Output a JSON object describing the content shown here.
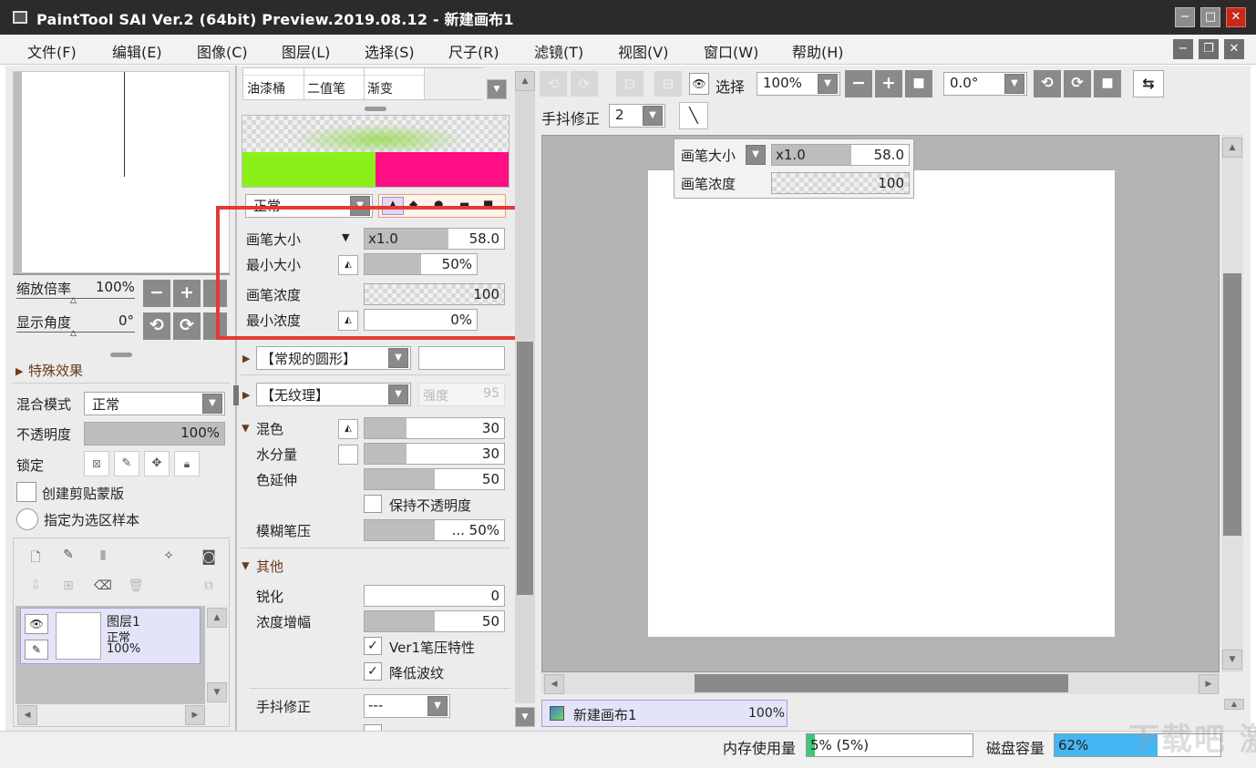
{
  "window": {
    "title": "PaintTool SAI Ver.2 (64bit) Preview.2019.08.12 - 新建画布1"
  },
  "menu": [
    "文件(F)",
    "编辑(E)",
    "图像(C)",
    "图层(L)",
    "选择(S)",
    "尺子(R)",
    "滤镜(T)",
    "视图(V)",
    "窗口(W)",
    "帮助(H)"
  ],
  "nav": {
    "zoom_label": "缩放倍率",
    "zoom_value": "100%",
    "angle_label": "显示角度",
    "angle_value": "0°"
  },
  "layer_props": {
    "effects_label": "特殊效果",
    "blend_label": "混合模式",
    "blend_value": "正常",
    "opacity_label": "不透明度",
    "opacity_value": "100%",
    "lock_label": "锁定",
    "clip_label": "创建剪贴蒙版",
    "selection_source_label": "指定为选区样本"
  },
  "layers": [
    {
      "name": "图层1",
      "mode": "正常",
      "opacity": "100%"
    }
  ],
  "tools": [
    "油漆桶",
    "二值笔",
    "渐变"
  ],
  "brush": {
    "mode_value": "正常",
    "size_label": "画笔大小",
    "size_multiplier": "x1.0",
    "size_value": "58.0",
    "size_fill": 0.6,
    "min_size_label": "最小大小",
    "min_size_value": "50%",
    "min_size_fill": 0.5,
    "density_label": "画笔浓度",
    "density_value": "100",
    "min_density_label": "最小浓度",
    "min_density_value": "0%",
    "shape_value": "【常规的圆形】",
    "texture_value": "【无纹理】",
    "strength_label": "强度",
    "strength_value": "95",
    "blending_label": "混色",
    "blending_value": "30",
    "blending_fill": 0.3,
    "water_label": "水分量",
    "water_value": "30",
    "water_fill": 0.3,
    "persistence_label": "色延伸",
    "persistence_value": "50",
    "persistence_fill": 0.5,
    "keep_opacity_label": "保持不透明度",
    "blur_label": "模糊笔压",
    "blur_value": "... 50%",
    "blur_fill": 0.5,
    "other_label": "其他",
    "sharpness_label": "锐化",
    "sharpness_value": "0",
    "density_boost_label": "浓度增幅",
    "density_boost_value": "50",
    "density_boost_fill": 0.5,
    "ver1_label": "Ver1笔压特性",
    "reduce_ripple_label": "降低波纹",
    "stabilizer_label": "手抖修正",
    "stabilizer_value": "---"
  },
  "canvas_toolbar": {
    "select_label": "选择",
    "zoom_value": "100%",
    "angle_value": "0.0°",
    "stabilizer_label": "手抖修正",
    "stabilizer_value": "2"
  },
  "overlay": {
    "size_label": "画笔大小",
    "size_multiplier": "x1.0",
    "size_value": "58.0",
    "density_label": "画笔浓度",
    "density_value": "100"
  },
  "documents": [
    {
      "name": "新建画布1",
      "zoom": "100%"
    }
  ],
  "status": {
    "memory_label": "内存使用量",
    "memory_value": "5% (5%)",
    "memory_fill": 0.05,
    "disk_label": "磁盘容量",
    "disk_value": "62%",
    "disk_fill": 0.62
  },
  "watermark": "下载吧 激活 Windows",
  "colors": {
    "highlight": "#e53935",
    "green": "#8bf01a",
    "magenta": "#ff0f83",
    "disk_bar": "#45b6f2",
    "memory_bar": "#3cc87a"
  }
}
